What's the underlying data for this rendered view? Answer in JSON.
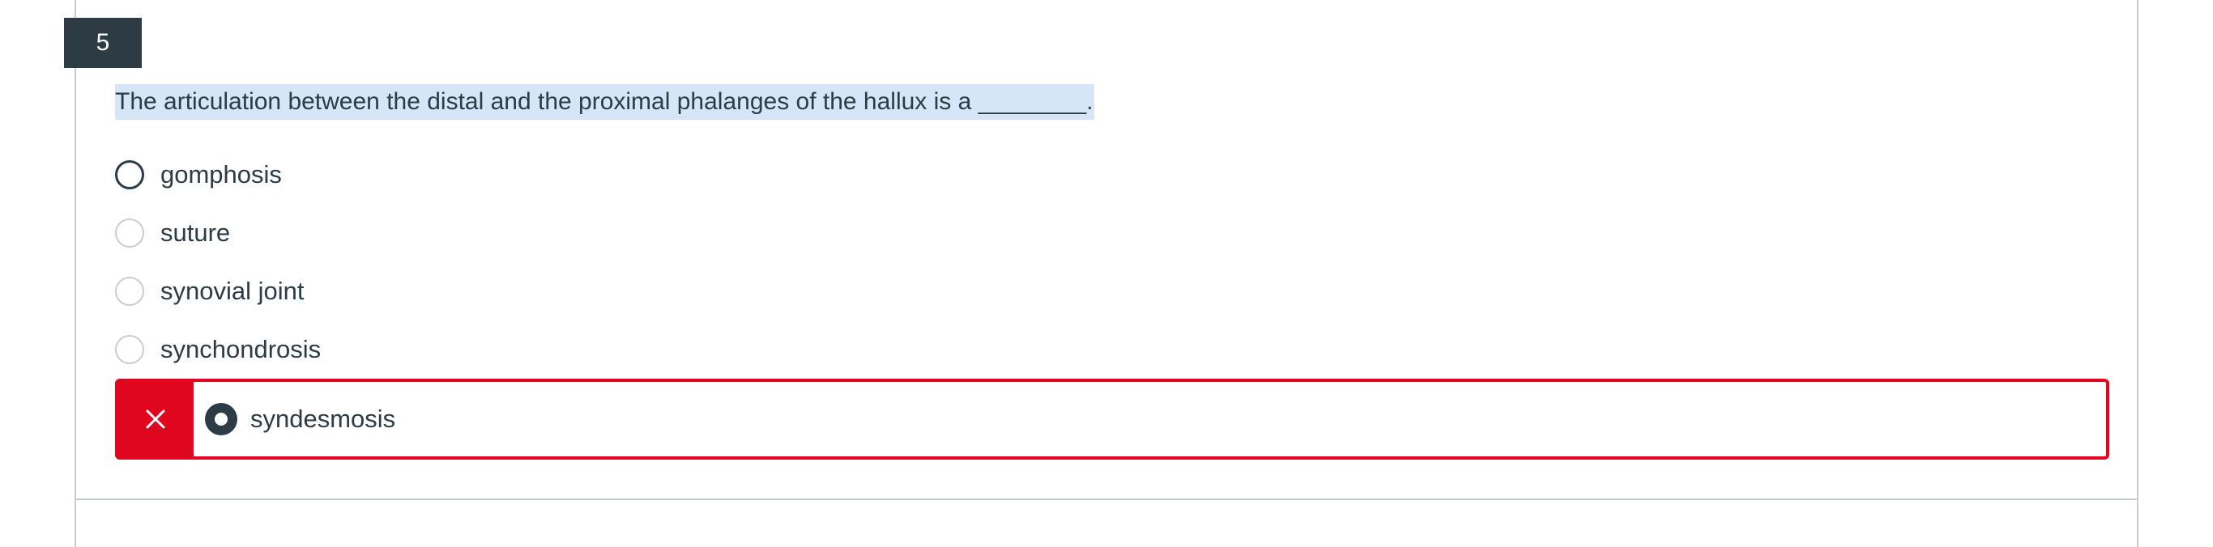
{
  "question": {
    "number": "5",
    "text": "The articulation between the distal and the proximal phalanges of the hallux is a ________."
  },
  "options": [
    {
      "label": "gomphosis",
      "selected": false
    },
    {
      "label": "suture",
      "selected": false
    },
    {
      "label": "synovial joint",
      "selected": false
    },
    {
      "label": "synchondrosis",
      "selected": false
    },
    {
      "label": "syndesmosis",
      "selected": true,
      "result": "incorrect"
    }
  ],
  "colors": {
    "accent_dark": "#2d3b45",
    "incorrect": "#e0061f",
    "highlight": "#d6e6f8",
    "border": "#c7cdd1"
  },
  "icons": {
    "incorrect_marker": "close-icon"
  }
}
